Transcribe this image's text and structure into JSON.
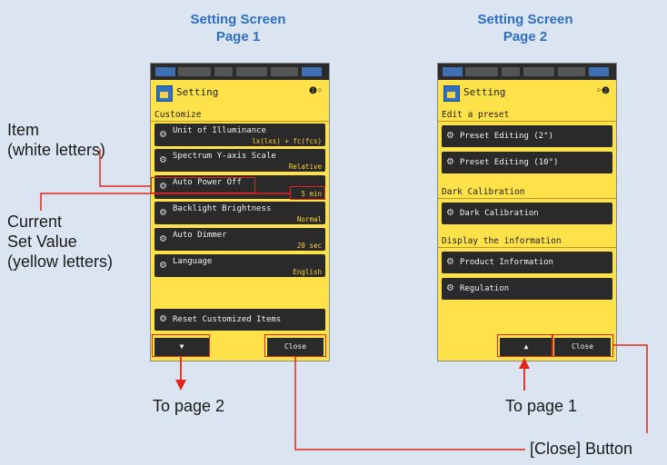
{
  "headings": {
    "page1": {
      "line1": "Setting Screen",
      "line2": "Page 1"
    },
    "page2": {
      "line1": "Setting Screen",
      "line2": "Page 2"
    }
  },
  "annotations": {
    "item": {
      "line1": "Item",
      "line2": "(white letters)"
    },
    "current": {
      "line1": "Current",
      "line2": "Set Value",
      "line3": "(yellow letters)"
    },
    "to_page2": "To page 2",
    "to_page1": "To page 1",
    "close_button": "[Close] Button"
  },
  "colors": {
    "accent_blue": "#2f6fbe",
    "screen_yellow": "#ffe14a",
    "callout_red": "#e2261c",
    "value_yellow": "#ffd233"
  },
  "screen1": {
    "title": "Setting",
    "page_indicator": "❶◦",
    "section": "Customize",
    "items": [
      {
        "label": "Unit of Illuminance",
        "value": "lx(lxs) + fc(fcs)"
      },
      {
        "label": "Spectrum Y-axis Scale",
        "value": "Relative"
      },
      {
        "label": "Auto Power Off",
        "value": "5 min"
      },
      {
        "label": "Backlight Brightness",
        "value": "Normal"
      },
      {
        "label": "Auto Dimmer",
        "value": "20 sec"
      },
      {
        "label": "Language",
        "value": "English"
      }
    ],
    "reset": "Reset Customized Items",
    "down_button": "▼",
    "close_button": "Close"
  },
  "screen2": {
    "title": "Setting",
    "page_indicator": "◦❷",
    "sections": [
      "Edit a preset",
      "Dark Calibration",
      "Display the information"
    ],
    "items": [
      {
        "label": "Preset Editing (2°)"
      },
      {
        "label": "Preset Editing (10°)"
      },
      {
        "label": "Dark Calibration"
      },
      {
        "label": "Product Information"
      },
      {
        "label": "Regulation"
      }
    ],
    "up_button": "▲",
    "close_button": "Close"
  }
}
